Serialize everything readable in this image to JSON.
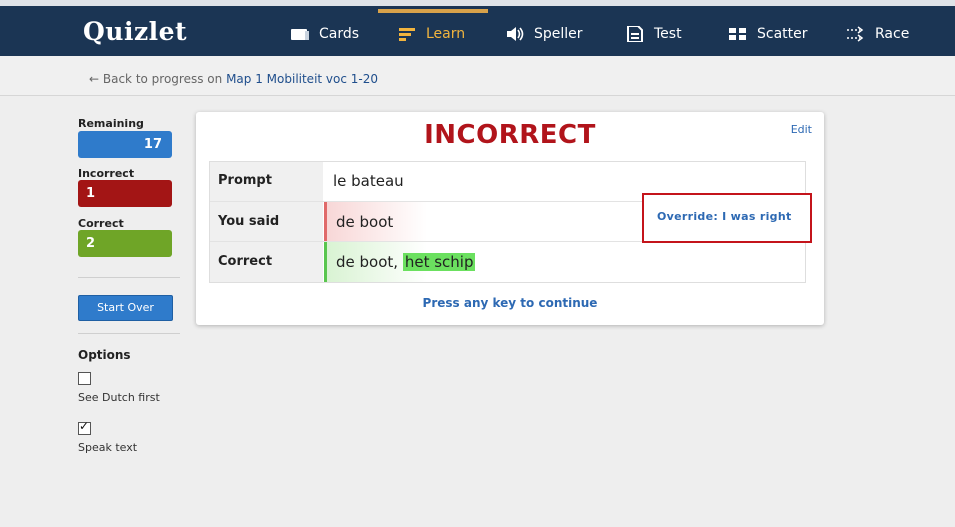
{
  "brand": {
    "logo": "Quizlet"
  },
  "nav": {
    "items": [
      {
        "label": "Cards",
        "icon": "cards-icon"
      },
      {
        "label": "Learn",
        "icon": "learn-icon",
        "active": true
      },
      {
        "label": "Speller",
        "icon": "speaker-icon"
      },
      {
        "label": "Test",
        "icon": "test-document-icon"
      },
      {
        "label": "Scatter",
        "icon": "scatter-icon"
      },
      {
        "label": "Race",
        "icon": "race-icon"
      }
    ]
  },
  "breadcrumb": {
    "back_text": "← Back to progress on",
    "set_name": "Map 1 Mobiliteit voc 1-20"
  },
  "sidebar": {
    "remaining_label": "Remaining",
    "remaining_value": "17",
    "incorrect_label": "Incorrect",
    "incorrect_value": "1",
    "correct_label": "Correct",
    "correct_value": "2",
    "start_over": "Start Over",
    "options_title": "Options",
    "options": [
      {
        "label": "See Dutch first",
        "checked": false
      },
      {
        "label": "Speak text",
        "checked": true
      }
    ]
  },
  "card": {
    "title": "INCORRECT",
    "edit": "Edit",
    "rows": {
      "prompt_label": "Prompt",
      "prompt_value": "le bateau",
      "said_label": "You said",
      "said_value": "de boot",
      "correct_label": "Correct",
      "correct_value_plain": "de boot,",
      "correct_value_highlight": "het schip"
    },
    "override": "Override: I was right",
    "continue": "Press any key to continue"
  },
  "colors": {
    "nav_bg": "#1b3554",
    "active_tab": "#f1b43e",
    "incorrect_title": "#b1141b",
    "remaining": "#2f7bcb",
    "incorrect": "#a31515",
    "correct": "#6fa527",
    "link": "#2d69b3"
  }
}
